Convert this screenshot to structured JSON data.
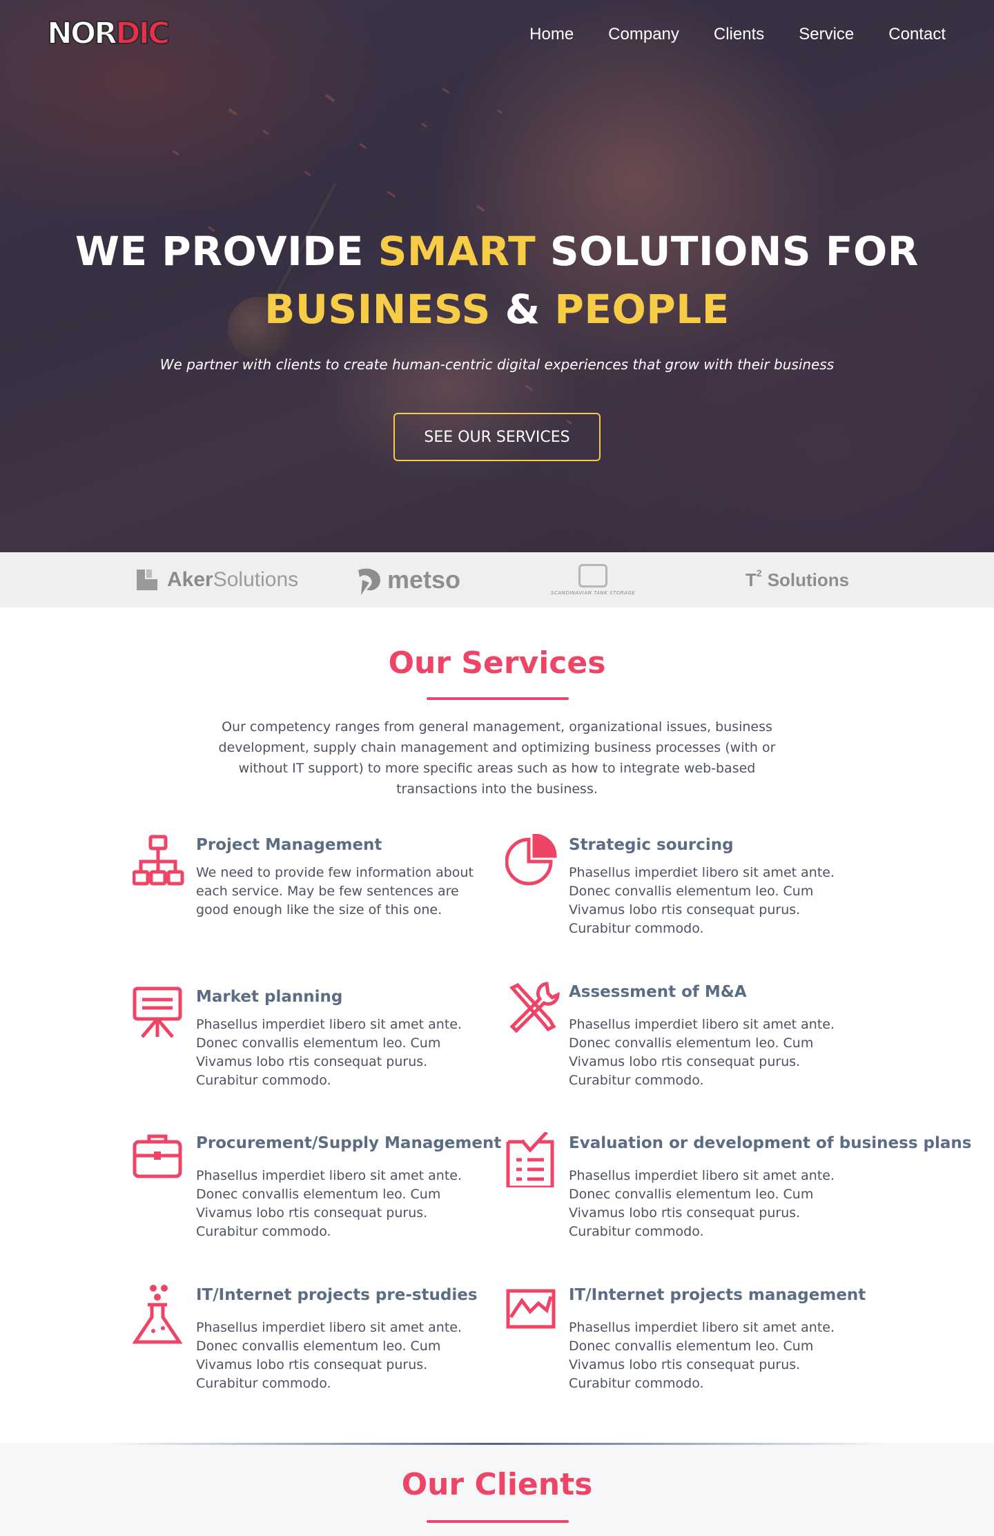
{
  "brand": {
    "logo_part1": "NOR",
    "logo_part2": "DIC",
    "accent_color": "#ee4466",
    "highlight_color": "#f7cd48"
  },
  "nav": {
    "items": [
      "Home",
      "Company",
      "Clients",
      "Service",
      "Contact"
    ]
  },
  "hero": {
    "title_1": "WE PROVIDE ",
    "title_2": "SMART",
    "title_3": " SOLUTIONS FOR",
    "title_4": "BUSINESS",
    "title_5": " & ",
    "title_6": "PEOPLE",
    "subtitle": "We partner with clients to create human-centric digital experiences that grow with their business",
    "button_label": "SEE OUR SERVICES"
  },
  "client_logos": {
    "aker_bold": "Aker",
    "aker_thin": "Solutions",
    "metso": "metso",
    "sts_caption": "SCANDINAVIAN TANK STORAGE",
    "t2_letter": "T",
    "t2_sup": "2",
    "t2_word": "Solutions"
  },
  "services": {
    "title": "Our Services",
    "intro": "Our competency ranges from general management, organizational issues, business development, supply chain management and optimizing business processes (with or without IT support) to more  specific areas such as how to integrate web-based transactions into the business.",
    "items": [
      {
        "title": "Project Management",
        "text": "We need to provide few information about each service. May be few sentences are good enough like the size of this one.",
        "icon": "org-chart-icon"
      },
      {
        "title": "Strategic sourcing",
        "text": "Phasellus imperdiet libero sit amet ante. Donec convallis elementum leo. Cum Vivamus lobo rtis consequat purus. Curabitur commodo.",
        "icon": "pie-chart-icon"
      },
      {
        "title": "Market planning",
        "text": "Phasellus imperdiet libero sit amet ante. Donec convallis elementum leo. Cum Vivamus lobo rtis consequat purus. Curabitur commodo.",
        "icon": "presentation-board-icon"
      },
      {
        "title": "Assessment of M&A",
        "text": "Phasellus imperdiet libero sit amet ante. Donec convallis elementum leo. Cum Vivamus lobo rtis consequat purus. Curabitur commodo.",
        "icon": "tools-icon"
      },
      {
        "title": "Procurement/Supply Management",
        "text": "Phasellus imperdiet libero sit amet ante. Donec convallis elementum leo. Cum Vivamus lobo rtis consequat purus. Curabitur commodo.",
        "icon": "briefcase-icon"
      },
      {
        "title": "Evaluation or development of business plans",
        "text": "Phasellus imperdiet libero sit amet ante. Donec convallis elementum leo. Cum Vivamus lobo rtis consequat purus. Curabitur commodo.",
        "icon": "checklist-icon"
      },
      {
        "title": "IT/Internet projects pre-studies",
        "text": "Phasellus imperdiet libero sit amet ante. Donec convallis elementum leo. Cum Vivamus lobo rtis consequat purus. Curabitur commodo.",
        "icon": "flask-icon"
      },
      {
        "title": "IT/Internet projects management",
        "text": "Phasellus imperdiet libero sit amet ante. Donec convallis elementum leo. Cum Vivamus lobo rtis consequat purus. Curabitur commodo.",
        "icon": "line-chart-icon"
      }
    ]
  },
  "clients": {
    "title": "Our Clients"
  }
}
